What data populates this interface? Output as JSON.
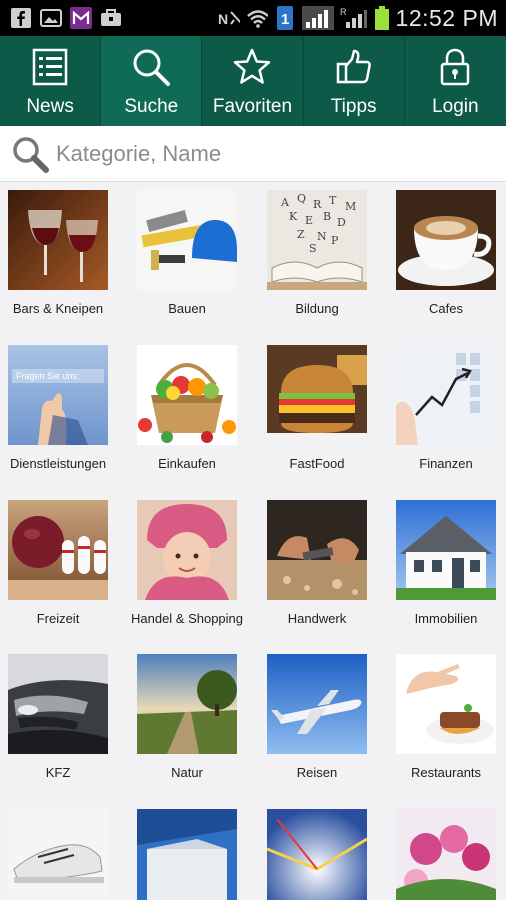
{
  "status_bar": {
    "time": "12:52 PM",
    "notification_icons": [
      "facebook-icon",
      "gallery-icon",
      "gmail-icon",
      "briefcase-icon"
    ],
    "system_icons": [
      "nfc-icon",
      "wifi-icon",
      "network-1-icon",
      "signal-icon",
      "roaming-signal-icon",
      "battery-icon"
    ]
  },
  "nav": {
    "items": [
      {
        "label": "News",
        "icon": "list-icon"
      },
      {
        "label": "Suche",
        "icon": "search-icon"
      },
      {
        "label": "Favoriten",
        "icon": "star-icon"
      },
      {
        "label": "Tipps",
        "icon": "thumbs-up-icon"
      },
      {
        "label": "Login",
        "icon": "lock-icon"
      }
    ],
    "active": "Suche",
    "colors": {
      "bar": "#0c5a47",
      "active": "#0f6b55"
    }
  },
  "search": {
    "placeholder": "Kategorie, Name",
    "value": ""
  },
  "categories": [
    {
      "label": "Bars & Kneipen"
    },
    {
      "label": "Bauen"
    },
    {
      "label": "Bildung"
    },
    {
      "label": "Cafes"
    },
    {
      "label": "Dienstleistungen",
      "overlay_text": "Fragen Sie uns:"
    },
    {
      "label": "Einkaufen"
    },
    {
      "label": "FastFood"
    },
    {
      "label": "Finanzen"
    },
    {
      "label": "Freizeit"
    },
    {
      "label": "Handel & Shopping"
    },
    {
      "label": "Handwerk"
    },
    {
      "label": "Immobilien"
    },
    {
      "label": "KFZ"
    },
    {
      "label": "Natur"
    },
    {
      "label": "Reisen"
    },
    {
      "label": "Restaurants"
    },
    {
      "label": ""
    },
    {
      "label": ""
    },
    {
      "label": ""
    },
    {
      "label": ""
    }
  ]
}
